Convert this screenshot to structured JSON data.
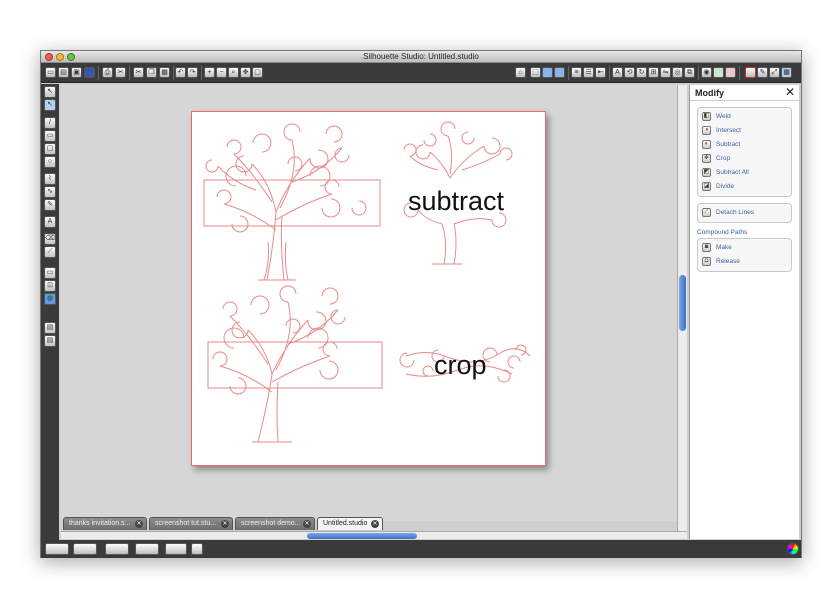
{
  "window": {
    "title": "Silhouette Studio: Untitled.studio"
  },
  "canvas": {
    "word_subtract": "subtract",
    "word_crop": "crop"
  },
  "tabs": [
    {
      "label": "thanks invitation.s..."
    },
    {
      "label": "screenshot tut.stu..."
    },
    {
      "label": "screenshot demo..."
    },
    {
      "label": "Untitled.studio",
      "active": true
    }
  ],
  "panel": {
    "title": "Modify",
    "close": "✕",
    "modify_items": [
      "Weld",
      "Intersect",
      "Subtract",
      "Crop",
      "Subtract All",
      "Divide"
    ],
    "detach_label": "Detach Lines",
    "compound_title": "Compound Paths",
    "compound_items": [
      "Make",
      "Release"
    ]
  },
  "colors": {
    "cut_line": "#e88a8a",
    "accent": "#3c72c9",
    "toolbar_bg": "#3a3a3a"
  }
}
